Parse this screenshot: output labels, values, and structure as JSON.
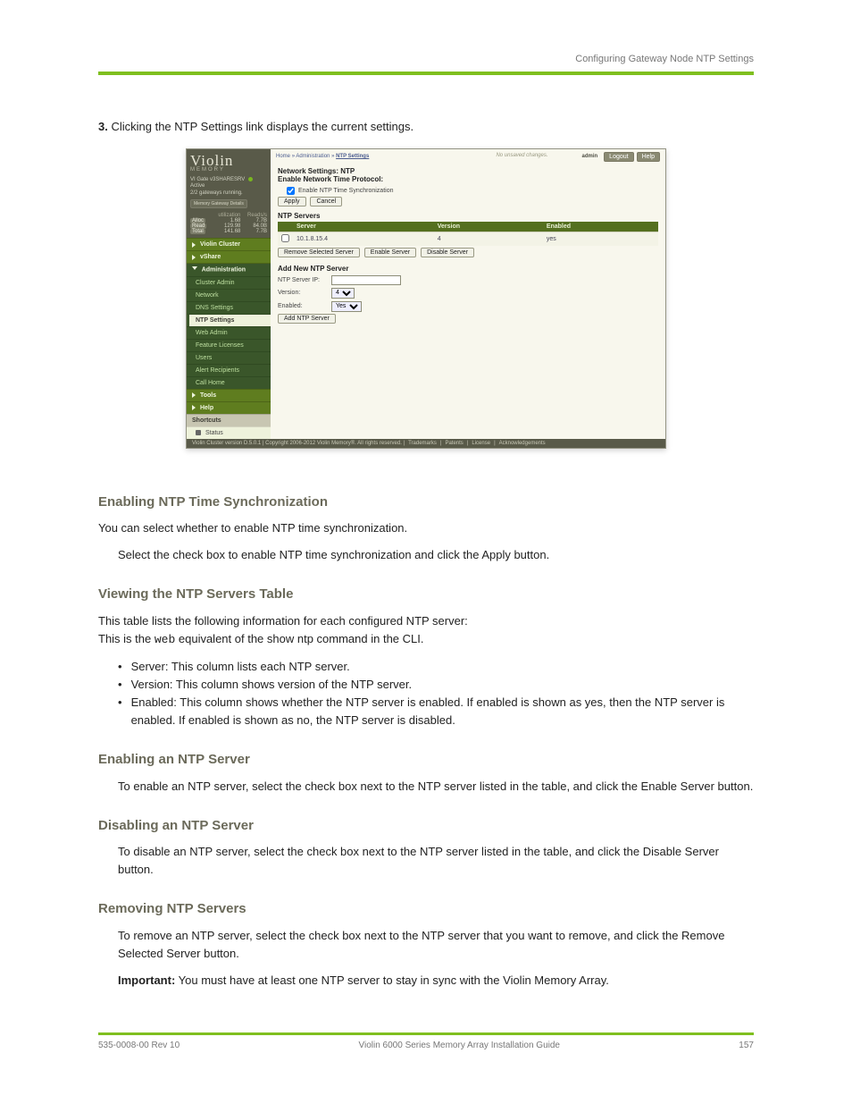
{
  "doc": {
    "header_right": "Configuring Gateway Node NTP Settings",
    "intro": "Clicking the NTP Settings link displays the current settings.",
    "step_label": "3.",
    "body": {
      "enable_title": "Enabling NTP Time Synchronization",
      "enable_p1": "You can select whether to enable NTP time synchronization.",
      "enable_p2": "Select the check box to enable NTP time synchronization and click the Apply button.",
      "table_title": "Viewing the NTP Servers Table",
      "table_p1": "This table lists the following information for each configured NTP server:",
      "bullets": [
        "Server: This column lists each NTP server.",
        "Version: This column shows version of the NTP server.",
        "Enabled: This column shows whether the NTP server is enabled. If enabled is shown as yes, then the NTP server is enabled. If enabled is shown as no, the NTP server is disabled."
      ],
      "enable_srv_title": "Enabling an NTP Server",
      "enable_srv_p": "To enable an NTP server, select the check box next to the NTP server listed in the table, and click the Enable Server button.",
      "disable_srv_title": "Disabling an NTP Server",
      "disable_srv_p": "To disable an NTP server, select the check box next to the NTP server listed in the table, and click the Disable Server button.",
      "remove_srv_title": "Removing NTP Servers",
      "remove_srv_p": "To remove an NTP server, select the check box next to the NTP server that you want to remove, and click the Remove Selected Server button.",
      "important_label": "Important:",
      "important_text": " You must have at least one NTP server to stay in sync with the Violin Memory Array."
    },
    "footer_left": "535-0008-00 Rev 10",
    "footer_center": "Violin 6000 Series Memory Array Installation Guide",
    "footer_right": "157"
  },
  "screenshot": {
    "logo": "Violin",
    "logo_sub": "MEMORY",
    "gw_status_line1": "VI Gate v3SHARESRV",
    "gw_status_line2": "Active",
    "gw_status_line3": "2/2 gateways running.",
    "gw_button": "Memory Gateway Details",
    "metrics": {
      "hdr_left": "utilization",
      "hdr_right": "Reads/s",
      "rows": [
        {
          "label": "Alloc",
          "a": "1.68",
          "b": "7.7B"
        },
        {
          "label": "Read",
          "a": "129.98",
          "b": "84.0B"
        },
        {
          "label": "Total",
          "a": "141.68",
          "b": "7.7B"
        }
      ]
    },
    "sidebar": {
      "groups": [
        {
          "label": "Violin Cluster",
          "kind": "hdr"
        },
        {
          "label": "vShare",
          "kind": "hdr"
        },
        {
          "label": "Administration",
          "kind": "hdr-open"
        }
      ],
      "admin_items": [
        {
          "label": "Cluster Admin",
          "active": false
        },
        {
          "label": "Network",
          "active": false
        },
        {
          "label": "DNS Settings",
          "active": false
        },
        {
          "label": "NTP Settings",
          "active": true
        },
        {
          "label": "Web Admin",
          "active": false
        },
        {
          "label": "Feature Licenses",
          "active": false
        },
        {
          "label": "Users",
          "active": false
        },
        {
          "label": "Alert Recipients",
          "active": false
        },
        {
          "label": "Call Home",
          "active": false
        }
      ],
      "tail_groups": [
        {
          "label": "Tools",
          "kind": "hdr"
        },
        {
          "label": "Help",
          "kind": "hdr"
        }
      ],
      "shortcuts_label": "Shortcuts",
      "shortcuts": [
        {
          "label": "Status"
        }
      ]
    },
    "crumbs": {
      "home": "Home",
      "admin": "Administration",
      "leaf": "NTP Settings",
      "sep": " » "
    },
    "status_msg": "No unsaved changes.",
    "user": "admin",
    "btn_logout": "Logout",
    "btn_help": "Help",
    "page": {
      "title": "Network Settings: NTP",
      "subtitle": "Enable Network Time Protocol:",
      "chk_label": "Enable NTP Time Synchronization",
      "btn_apply": "Apply",
      "btn_cancel": "Cancel",
      "servers_title": "NTP Servers",
      "tbl_hdr_server": "Server",
      "tbl_hdr_version": "Version",
      "tbl_hdr_enabled": "Enabled",
      "row": {
        "server": "10.1.8.15.4",
        "version": "4",
        "enabled": "yes"
      },
      "btn_remove": "Remove Selected Server",
      "btn_enable": "Enable Server",
      "btn_disable": "Disable Server",
      "add_title": "Add New NTP Server",
      "lbl_ip": "NTP Server IP:",
      "val_ip": "",
      "lbl_version": "Version:",
      "sel_version": "4",
      "lbl_enabled": "Enabled:",
      "sel_enabled": "Yes",
      "btn_add": "Add NTP Server"
    },
    "footer": {
      "text": "Violin Cluster version D.5.0.1 | Copyright 2006-2012 Violin Memory®. All rights reserved. | ",
      "links": [
        "Trademarks",
        "Patents",
        "License",
        "Acknowledgements"
      ]
    }
  }
}
